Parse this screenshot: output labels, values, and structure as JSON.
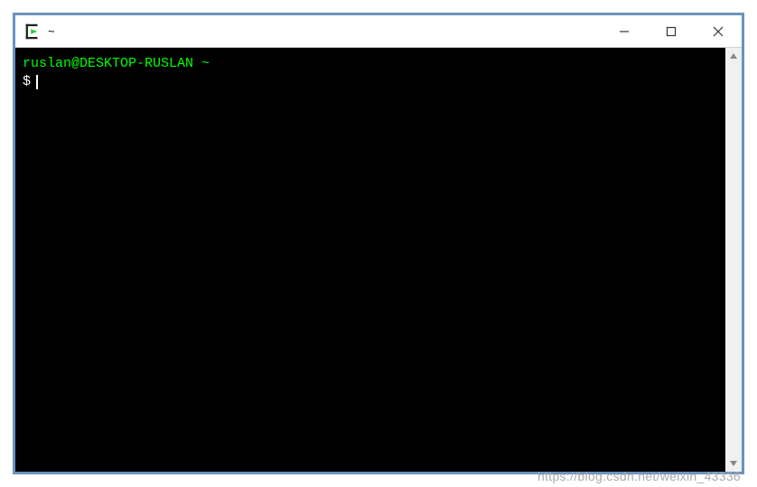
{
  "titlebar": {
    "title": "~"
  },
  "terminal": {
    "prompt_user_host": "ruslan@DESKTOP-RUSLAN",
    "prompt_path": "~",
    "prompt_symbol": "$"
  },
  "watermark": "https://blog.csdn.net/weixin_43336"
}
